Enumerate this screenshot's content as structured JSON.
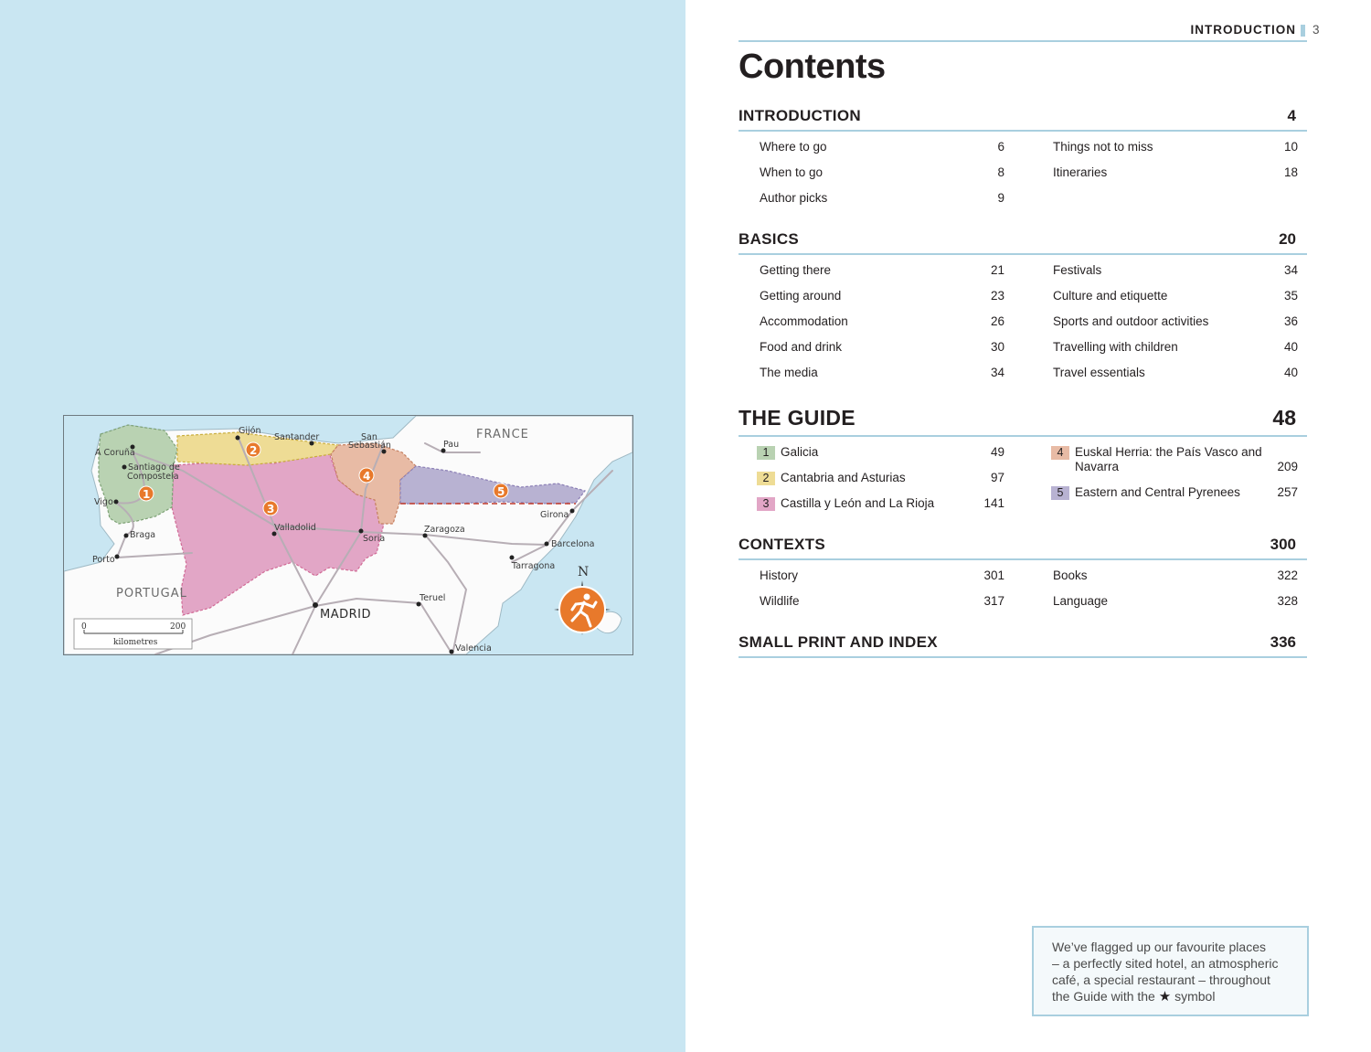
{
  "map": {
    "country_labels": [
      "FRANCE",
      "PORTUGAL"
    ],
    "capital": "MADRID",
    "cities": [
      "Gijón",
      "Santander",
      "San",
      "Sebastián",
      "Pau",
      "A Coruña",
      "Santiago de",
      "Compostela",
      "Vigo",
      "Braga",
      "Porto",
      "Valladolid",
      "Soria",
      "Zaragoza",
      "Girona",
      "Barcelona",
      "Tarragona",
      "Teruel",
      "Valencia"
    ],
    "region_numbers": [
      "1",
      "2",
      "3",
      "4",
      "5"
    ],
    "compass_letter": "N",
    "scale": {
      "start": "0",
      "end": "200",
      "unit": "kilometres"
    },
    "colors": {
      "region1": "#b9d2b2",
      "region2": "#eedc95",
      "region3": "#e2a6c6",
      "region4": "#e8bba5",
      "region5": "#b8b2d2",
      "marker": "#e8792b"
    },
    "icon": "running-figure-icon"
  },
  "header": {
    "section": "INTRODUCTION",
    "page_number": "3"
  },
  "title": "Contents",
  "sections": {
    "introduction": {
      "title": "INTRODUCTION",
      "page": "4",
      "left": [
        {
          "label": "Where to go",
          "page": "6"
        },
        {
          "label": "When to go",
          "page": "8"
        },
        {
          "label": "Author picks",
          "page": "9"
        }
      ],
      "right": [
        {
          "label": "Things not to miss",
          "page": "10"
        },
        {
          "label": "Itineraries",
          "page": "18"
        }
      ]
    },
    "basics": {
      "title": "BASICS",
      "page": "20",
      "left": [
        {
          "label": "Getting there",
          "page": "21"
        },
        {
          "label": "Getting around",
          "page": "23"
        },
        {
          "label": "Accommodation",
          "page": "26"
        },
        {
          "label": "Food and drink",
          "page": "30"
        },
        {
          "label": "The media",
          "page": "34"
        }
      ],
      "right": [
        {
          "label": "Festivals",
          "page": "34"
        },
        {
          "label": "Culture and etiquette",
          "page": "35"
        },
        {
          "label": "Sports and outdoor activities",
          "page": "36"
        },
        {
          "label": "Travelling with children",
          "page": "40"
        },
        {
          "label": "Travel essentials",
          "page": "40"
        }
      ]
    },
    "guide": {
      "title": "THE GUIDE",
      "page": "48",
      "left": [
        {
          "num": "1",
          "label": "Galicia",
          "page": "49"
        },
        {
          "num": "2",
          "label": "Cantabria and Asturias",
          "page": "97"
        },
        {
          "num": "3",
          "label": "Castilla y León and La Rioja",
          "page": "141"
        }
      ],
      "right": [
        {
          "num": "4",
          "label_line1": "Euskal Herria: the País Vasco and",
          "label_line2": "Navarra",
          "page": "209"
        },
        {
          "num": "5",
          "label": "Eastern and Central Pyrenees",
          "page": "257"
        }
      ]
    },
    "contexts": {
      "title": "CONTEXTS",
      "page": "300",
      "left": [
        {
          "label": "History",
          "page": "301"
        },
        {
          "label": "Wildlife",
          "page": "317"
        }
      ],
      "right": [
        {
          "label": "Books",
          "page": "322"
        },
        {
          "label": "Language",
          "page": "328"
        }
      ]
    },
    "small_print": {
      "title": "SMALL PRINT AND INDEX",
      "page": "336"
    }
  },
  "note": {
    "lines": [
      "We’ve flagged up our favourite places",
      "– a perfectly sited hotel, an atmospheric",
      "café, a special restaurant – throughout"
    ],
    "last_before": "the Guide with the",
    "last_after": "symbol",
    "icon": "star-icon"
  }
}
